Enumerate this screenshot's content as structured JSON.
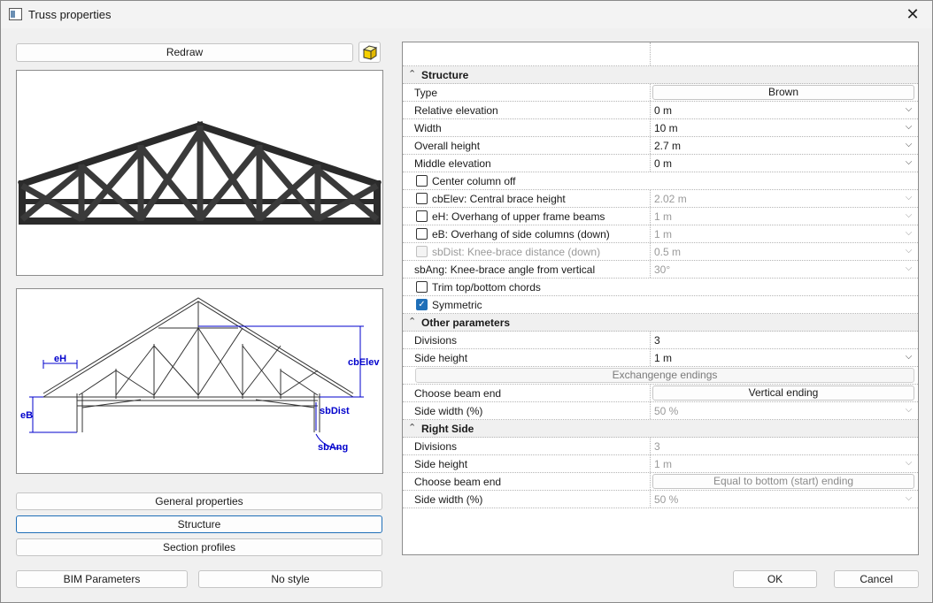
{
  "window": {
    "title": "Truss properties"
  },
  "buttons": {
    "redraw": "Redraw",
    "general_properties": "General properties",
    "structure": "Structure",
    "section_profiles": "Section profiles",
    "bim_parameters": "BIM Parameters",
    "no_style": "No style",
    "ok": "OK",
    "cancel": "Cancel"
  },
  "diagram": {
    "labels": {
      "eH": "eH",
      "eB": "eB",
      "cbElev": "cbElev",
      "sbDist": "sbDist",
      "sbAng": "sbAng"
    }
  },
  "grid": {
    "categories": {
      "structure": "Structure",
      "other": "Other parameters",
      "right": "Right Side"
    },
    "rows": {
      "type": {
        "label": "Type",
        "value": "Brown"
      },
      "relative_elevation": {
        "label": "Relative elevation",
        "value": "0 m"
      },
      "width": {
        "label": "Width",
        "value": "10 m"
      },
      "overall_height": {
        "label": "Overall height",
        "value": "2.7 m"
      },
      "middle_elevation": {
        "label": "Middle elevation",
        "value": "0 m"
      },
      "center_column_off": {
        "label": "Center column off",
        "checked": false
      },
      "cb_elev": {
        "label": "cbElev: Central brace height",
        "value": "2.02 m",
        "checked": false
      },
      "e_h": {
        "label": "eH: Overhang of upper frame beams",
        "value": "1 m",
        "checked": false
      },
      "e_b": {
        "label": "eB: Overhang of side columns (down)",
        "value": "1 m",
        "checked": false
      },
      "sb_dist": {
        "label": "sbDist: Knee-brace distance (down)",
        "value": "0.5 m",
        "checked": false
      },
      "sb_ang": {
        "label": "sbAng: Knee-brace angle from vertical",
        "value": "30°"
      },
      "trim": {
        "label": "Trim top/bottom chords",
        "checked": false
      },
      "symmetric": {
        "label": "Symmetric",
        "checked": true
      },
      "divisions": {
        "label": "Divisions",
        "value": "3"
      },
      "side_height": {
        "label": "Side height",
        "value": "1 m"
      },
      "exchange": {
        "label": "Exchangenge endings"
      },
      "choose_beam_end": {
        "label": "Choose beam end",
        "value": "Vertical ending"
      },
      "side_width": {
        "label": "Side width (%)",
        "value": "50 %"
      },
      "r_divisions": {
        "label": "Divisions",
        "value": "3"
      },
      "r_side_height": {
        "label": "Side height",
        "value": "1 m"
      },
      "r_choose_beam_end": {
        "label": "Choose beam end",
        "value": "Equal to bottom (start) ending"
      },
      "r_side_width": {
        "label": "Side width (%)",
        "value": "50 %"
      }
    }
  }
}
